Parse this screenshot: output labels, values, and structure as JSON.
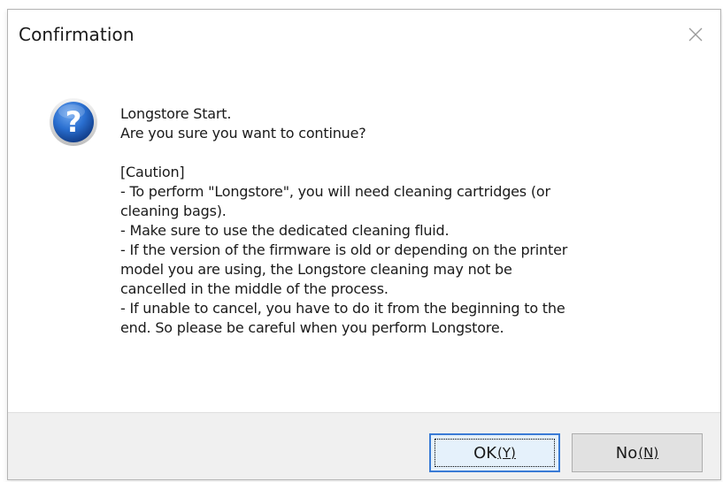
{
  "window": {
    "title": "Confirmation",
    "close_icon": "close-icon"
  },
  "message": {
    "icon": "question-icon",
    "lines": [
      "Longstore Start.",
      "Are you sure you want to continue?",
      "",
      "[Caution]",
      "- To perform \"Longstore\", you will need cleaning cartridges (or",
      "cleaning bags).",
      "- Make sure to use the dedicated cleaning fluid.",
      "- If the version of the firmware is old or depending on the printer",
      "model you are using, the Longstore cleaning may not be",
      "cancelled in the middle of the process.",
      "- If unable to cancel, you have to do it from the beginning to the",
      "end. So please be careful when you perform Longstore."
    ]
  },
  "buttons": {
    "ok_label": "OK",
    "ok_mnemonic": "(Y)",
    "no_label": "No",
    "no_mnemonic": "(N)"
  },
  "colors": {
    "focus_border": "#3a7bd5",
    "footer_bg": "#f0f0f0",
    "icon_blue": "#1f5fb8"
  }
}
